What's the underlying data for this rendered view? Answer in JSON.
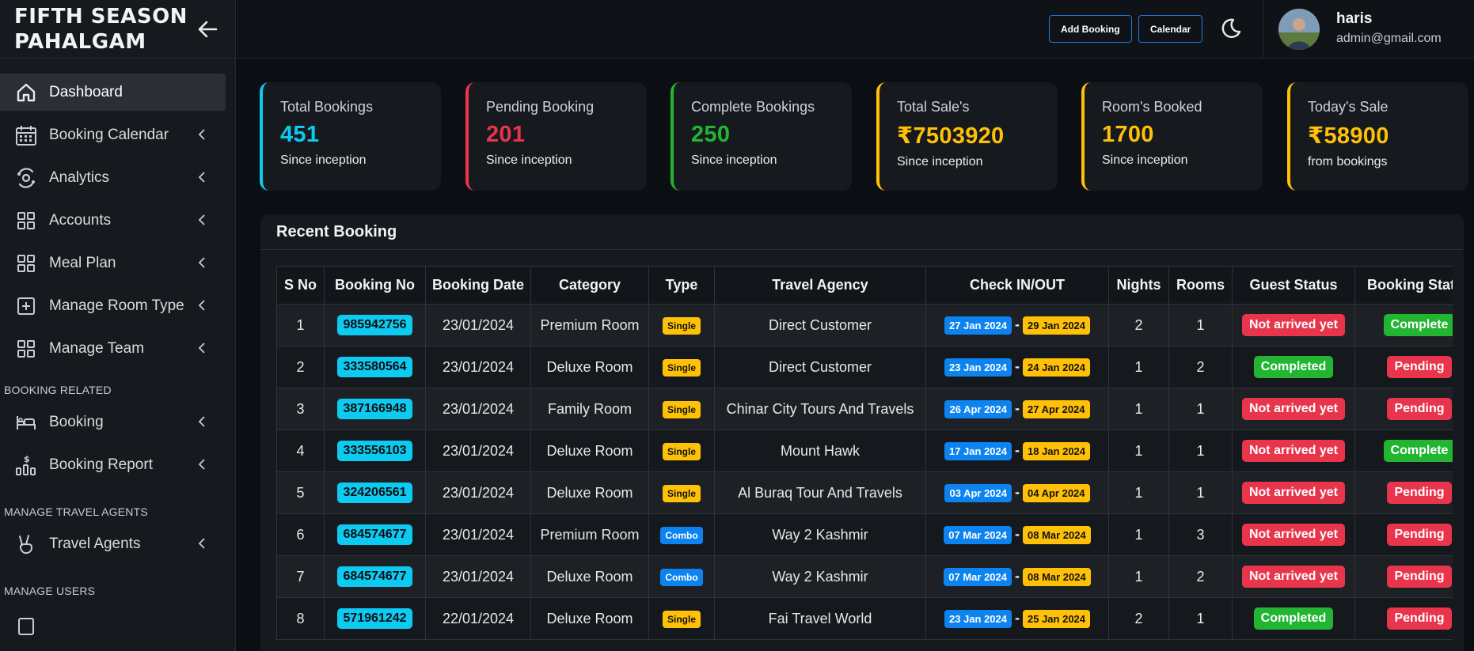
{
  "brand": {
    "title": "FIFTH SEASON PAHALGAM"
  },
  "sidebar": {
    "items": [
      {
        "label": "Dashboard",
        "icon": "home-icon",
        "active": true
      },
      {
        "label": "Booking Calendar",
        "icon": "calendar-icon"
      },
      {
        "label": "Analytics",
        "icon": "analytics-icon"
      },
      {
        "label": "Accounts",
        "icon": "grid-icon"
      },
      {
        "label": "Meal Plan",
        "icon": "grid-icon"
      },
      {
        "label": "Manage Room Type",
        "icon": "plus-square-icon"
      },
      {
        "label": "Manage Team",
        "icon": "grid-icon"
      }
    ],
    "sections": [
      {
        "header": "BOOKING RELATED",
        "items": [
          {
            "label": "Booking",
            "icon": "bed-icon"
          },
          {
            "label": "Booking Report",
            "icon": "report-icon"
          }
        ]
      },
      {
        "header": "MANAGE TRAVEL AGENTS",
        "items": [
          {
            "label": "Travel Agents",
            "icon": "peace-hand-icon"
          }
        ]
      },
      {
        "header": "MANAGE USERS",
        "items": []
      }
    ]
  },
  "header": {
    "add_booking": "Add Booking",
    "calendar": "Calendar",
    "user": {
      "name": "haris",
      "email": "admin@gmail.com"
    }
  },
  "stats": [
    {
      "title": "Total Bookings",
      "value": "451",
      "sub": "Since inception",
      "color": "#0dcaf0"
    },
    {
      "title": "Pending Booking",
      "value": "201",
      "sub": "Since inception",
      "color": "#e8354c"
    },
    {
      "title": "Complete Bookings",
      "value": "250",
      "sub": "Since inception",
      "color": "#22b532"
    },
    {
      "title": "Total Sale's",
      "value": "₹7503920",
      "sub": "Since inception",
      "color": "#ffc107"
    },
    {
      "title": "Room's Booked",
      "value": "1700",
      "sub": "Since inception",
      "color": "#ffc107"
    },
    {
      "title": "Today's Sale",
      "value": "₹58900",
      "sub": "from bookings",
      "color": "#ffc107"
    }
  ],
  "recent": {
    "title": "Recent Booking",
    "columns": [
      "S No",
      "Booking No",
      "Booking Date",
      "Category",
      "Type",
      "Travel Agency",
      "Check IN/OUT",
      "Nights",
      "Rooms",
      "Guest Status",
      "Booking Status"
    ],
    "rows": [
      {
        "sno": "1",
        "booking_no": "985942756",
        "date": "23/01/2024",
        "category": "Premium Room",
        "type": "Single",
        "agency": "Direct Customer",
        "check_in": "27 Jan 2024",
        "check_out": "29 Jan 2024",
        "nights": "2",
        "rooms": "1",
        "guest_status": "Not arrived yet",
        "booking_status": "Complete"
      },
      {
        "sno": "2",
        "booking_no": "333580564",
        "date": "23/01/2024",
        "category": "Deluxe Room",
        "type": "Single",
        "agency": "Direct Customer",
        "check_in": "23 Jan 2024",
        "check_out": "24 Jan 2024",
        "nights": "1",
        "rooms": "2",
        "guest_status": "Completed",
        "booking_status": "Pending"
      },
      {
        "sno": "3",
        "booking_no": "387166948",
        "date": "23/01/2024",
        "category": "Family Room",
        "type": "Single",
        "agency": "Chinar City Tours And Travels",
        "check_in": "26 Apr 2024",
        "check_out": "27 Apr 2024",
        "nights": "1",
        "rooms": "1",
        "guest_status": "Not arrived yet",
        "booking_status": "Pending"
      },
      {
        "sno": "4",
        "booking_no": "333556103",
        "date": "23/01/2024",
        "category": "Deluxe Room",
        "type": "Single",
        "agency": "Mount Hawk",
        "check_in": "17 Jan 2024",
        "check_out": "18 Jan 2024",
        "nights": "1",
        "rooms": "1",
        "guest_status": "Not arrived yet",
        "booking_status": "Complete"
      },
      {
        "sno": "5",
        "booking_no": "324206561",
        "date": "23/01/2024",
        "category": "Deluxe Room",
        "type": "Single",
        "agency": "Al Buraq Tour And Travels",
        "check_in": "03 Apr 2024",
        "check_out": "04 Apr 2024",
        "nights": "1",
        "rooms": "1",
        "guest_status": "Not arrived yet",
        "booking_status": "Pending"
      },
      {
        "sno": "6",
        "booking_no": "684574677",
        "date": "23/01/2024",
        "category": "Premium Room",
        "type": "Combo",
        "agency": "Way 2 Kashmir",
        "check_in": "07 Mar 2024",
        "check_out": "08 Mar 2024",
        "nights": "1",
        "rooms": "3",
        "guest_status": "Not arrived yet",
        "booking_status": "Pending"
      },
      {
        "sno": "7",
        "booking_no": "684574677",
        "date": "23/01/2024",
        "category": "Deluxe Room",
        "type": "Combo",
        "agency": "Way 2 Kashmir",
        "check_in": "07 Mar 2024",
        "check_out": "08 Mar 2024",
        "nights": "1",
        "rooms": "2",
        "guest_status": "Not arrived yet",
        "booking_status": "Pending"
      },
      {
        "sno": "8",
        "booking_no": "571961242",
        "date": "22/01/2024",
        "category": "Deluxe Room",
        "type": "Single",
        "agency": "Fai Travel World",
        "check_in": "23 Jan 2024",
        "check_out": "25 Jan 2024",
        "nights": "2",
        "rooms": "1",
        "guest_status": "Completed",
        "booking_status": "Pending"
      }
    ]
  }
}
